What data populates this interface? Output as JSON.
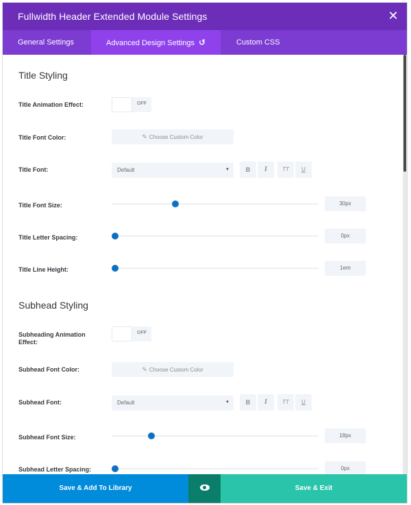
{
  "header": {
    "title": "Fullwidth Header Extended Module Settings",
    "close_icon": "close-icon"
  },
  "tabs": [
    {
      "label": "General Settings",
      "active": false
    },
    {
      "label": "Advanced Design Settings",
      "active": true,
      "icon": "reset-icon"
    },
    {
      "label": "Custom CSS",
      "active": false
    }
  ],
  "title_section": {
    "heading": "Title Styling",
    "animation": {
      "label": "Title Animation Effect:",
      "state": "OFF"
    },
    "font_color": {
      "label": "Title Font Color:",
      "button": "Choose Custom Color"
    },
    "font": {
      "label": "Title Font:",
      "value": "Default",
      "bold": "B",
      "italic": "I",
      "uppercase": "TT",
      "underline": "U"
    },
    "font_size": {
      "label": "Title Font Size:",
      "value": "30px",
      "level": 0.3
    },
    "letter_spacing": {
      "label": "Title Letter Spacing:",
      "value": "0px",
      "level": 0
    },
    "line_height": {
      "label": "Title Line Height:",
      "value": "1em",
      "level": 0
    }
  },
  "subhead_section": {
    "heading": "Subhead Styling",
    "animation": {
      "label": "Subheading Animation Effect:",
      "state": "OFF"
    },
    "font_color": {
      "label": "Subhead Font Color:",
      "button": "Choose Custom Color"
    },
    "font": {
      "label": "Subhead Font:",
      "value": "Default",
      "bold": "B",
      "italic": "I",
      "uppercase": "TT",
      "underline": "U"
    },
    "font_size": {
      "label": "Subhead Font Size:",
      "value": "18px",
      "level": 0.18
    },
    "letter_spacing": {
      "label": "Subhead Letter Spacing:",
      "value": "0px",
      "level": 0
    }
  },
  "footer": {
    "library_button": "Save & Add To Library",
    "preview_icon": "eye-icon",
    "save_button": "Save & Exit"
  },
  "colors": {
    "header": "#6c2eb9",
    "tabs": "#7c3bd1",
    "active_tab": "#8f42ec",
    "slider": "#0c71c3",
    "library_button": "#008bdb",
    "preview_button": "#0a7e6a",
    "save_button": "#29c4a9"
  }
}
